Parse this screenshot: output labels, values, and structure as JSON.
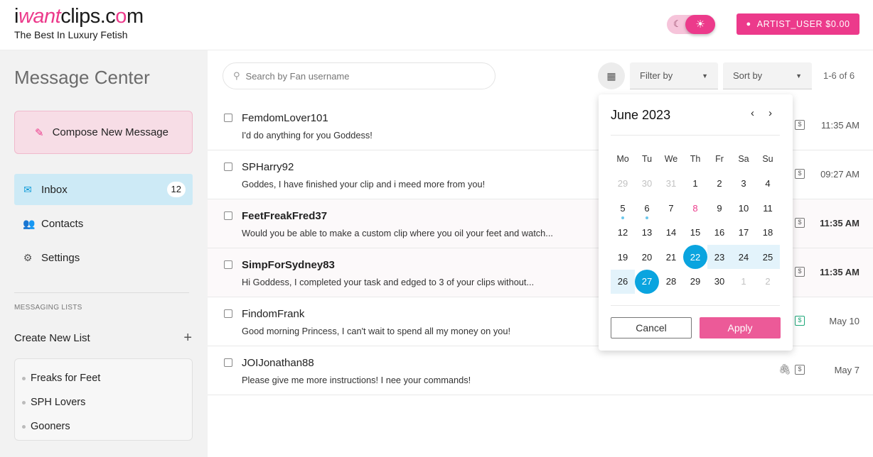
{
  "header": {
    "logo_text": "iwantclips.com",
    "tagline": "The Best In Luxury Fetish",
    "user_button": "ARTIST_USER $0.00",
    "icons": {
      "moon": "moon-icon",
      "sun": "sun-icon",
      "user": "user-icon"
    },
    "brand_color": "#ec3a8b"
  },
  "sidebar": {
    "title": "Message Center",
    "compose_label": "Compose New Message",
    "nav": [
      {
        "label": "Inbox",
        "icon": "mail-icon",
        "badge": "12",
        "active": true
      },
      {
        "label": "Contacts",
        "icon": "people-icon"
      },
      {
        "label": "Settings",
        "icon": "gear-icon"
      }
    ],
    "section_label": "MESSAGING LISTS",
    "create_list_label": "Create New List",
    "create_list_plus": "+",
    "lists": [
      "Freaks for Feet",
      "SPH Lovers",
      "Gooners"
    ]
  },
  "toolbar": {
    "search_placeholder": "Search by Fan username",
    "filter_label": "Filter by",
    "sort_label": "Sort by",
    "count": "1-6 of 6"
  },
  "messages": [
    {
      "name": "FemdomLover101",
      "preview": "I'd do anything for you Goddess!",
      "time": "11:35 AM",
      "unread": false,
      "attachment": false,
      "payment_icon": "$"
    },
    {
      "name": "SPHarry92",
      "preview": "Goddes, I have finished your clip and i meed more from you!",
      "time": "09:27 AM",
      "unread": false,
      "attachment": false,
      "payment_icon": "$"
    },
    {
      "name": "FeetFreakFred37",
      "preview": "Would you be able to make a custom clip where you oil your feet and watch...",
      "time": "11:35 AM",
      "unread": true,
      "attachment": false,
      "payment_icon": "$"
    },
    {
      "name": "SimpForSydney83",
      "preview": "Hi Goddess, I completed your task and edged to 3 of your clips without...",
      "time": "11:35 AM",
      "unread": true,
      "attachment": false,
      "payment_icon": "$"
    },
    {
      "name": "FindomFrank",
      "preview": "Good morning Princess, I can't wait to spend all my money on you!",
      "time": "May 10",
      "unread": false,
      "attachment": false,
      "payment_icon": "$",
      "paid": true
    },
    {
      "name": "JOIJonathan88",
      "preview": "Please give me more instructions! I nee your commands!",
      "time": "May 7",
      "unread": false,
      "attachment": true,
      "payment_icon": "$"
    }
  ],
  "calendar": {
    "month_label": "June 2023",
    "prev": "‹",
    "next": "›",
    "weekdays": [
      "Mo",
      "Tu",
      "We",
      "Th",
      "Fr",
      "Sa",
      "Su"
    ],
    "weeks": [
      [
        "29",
        "30",
        "31",
        "1",
        "2",
        "3",
        "4"
      ],
      [
        "5",
        "6",
        "7",
        "8",
        "9",
        "10",
        "11"
      ],
      [
        "12",
        "13",
        "14",
        "15",
        "16",
        "17",
        "18"
      ],
      [
        "19",
        "20",
        "21",
        "22",
        "23",
        "24",
        "25"
      ],
      [
        "26",
        "27",
        "28",
        "29",
        "30",
        "1",
        "2"
      ]
    ],
    "range_start": "22",
    "range_end": "27",
    "today": "8",
    "marked_days": [
      "5",
      "6"
    ],
    "cancel_label": "Cancel",
    "apply_label": "Apply",
    "accent_color": "#0aa4df"
  }
}
